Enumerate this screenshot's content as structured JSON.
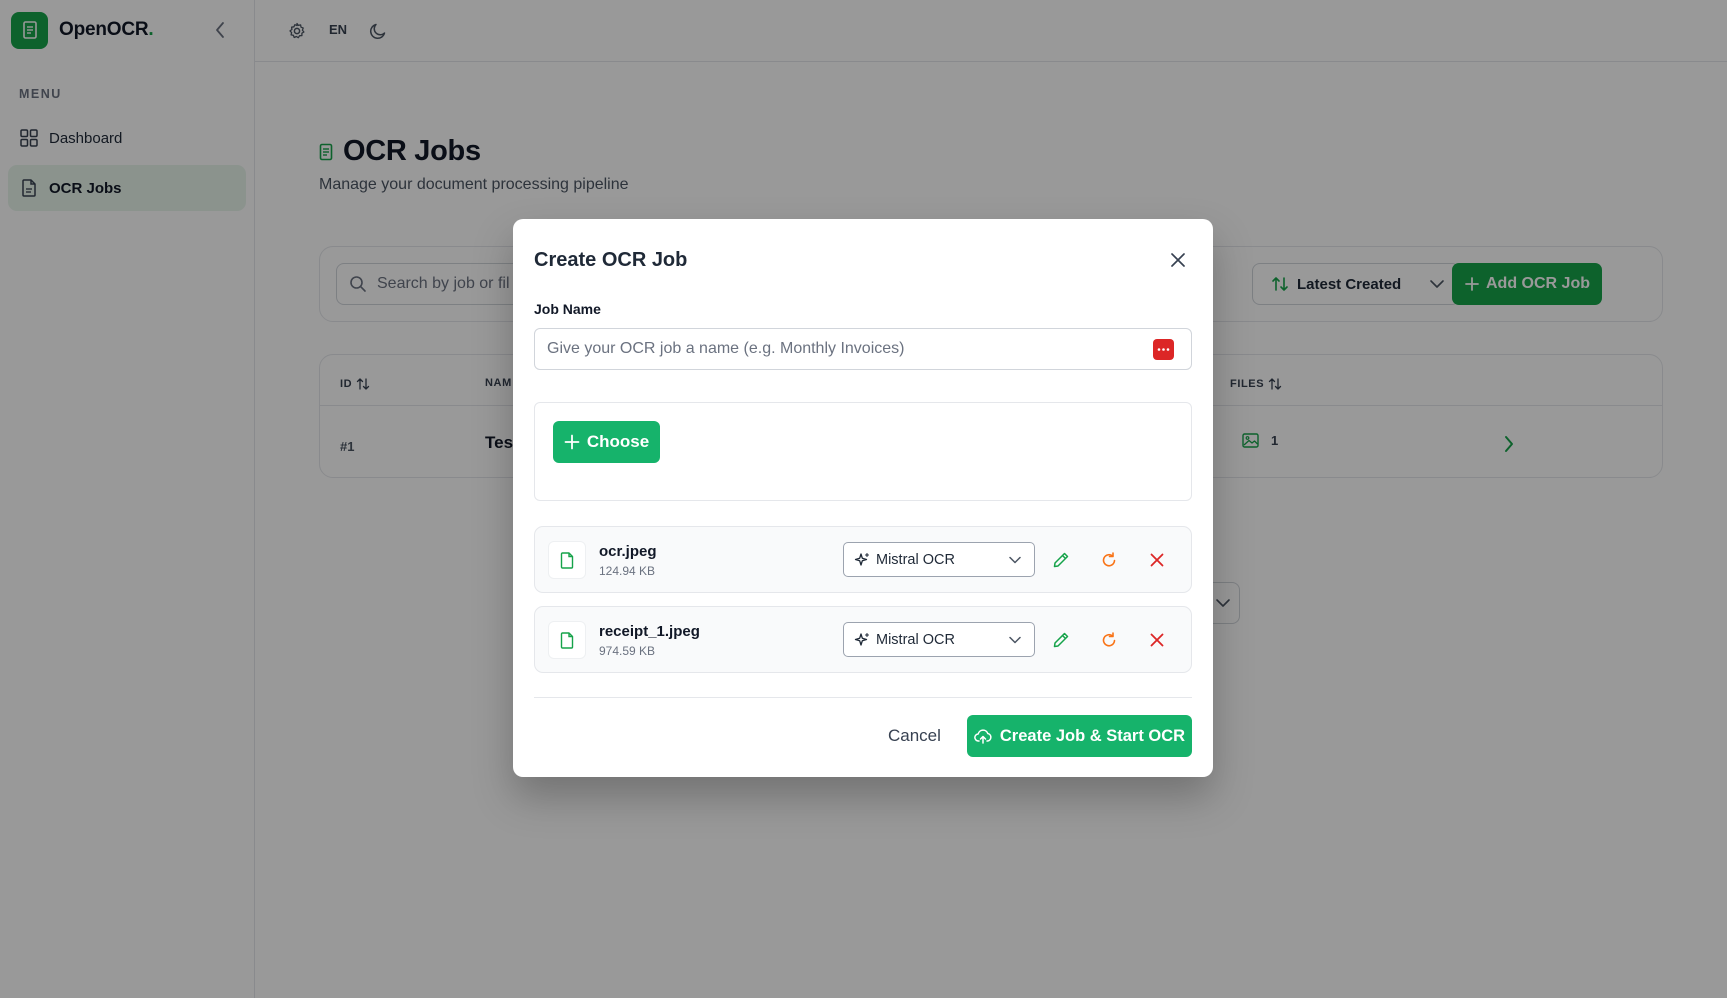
{
  "app": {
    "name": "OpenOCR",
    "name_suffix": "."
  },
  "sidebar": {
    "menu_label": "MENU",
    "items": [
      {
        "label": "Dashboard",
        "icon": "grid-icon",
        "active": false
      },
      {
        "label": "OCR Jobs",
        "icon": "document-icon",
        "active": true
      }
    ]
  },
  "topbar": {
    "language": "EN"
  },
  "page": {
    "title": "OCR Jobs",
    "subtitle": "Manage your document processing pipeline"
  },
  "toolbar": {
    "search_placeholder": "Search by job or fil",
    "sort_label": "Latest Created",
    "add_label": "Add OCR Job"
  },
  "table": {
    "columns": [
      "ID",
      "NAM",
      "FILES"
    ],
    "rows": [
      {
        "id": "#1",
        "name": "Tes",
        "files": "1"
      }
    ]
  },
  "modal": {
    "title": "Create OCR Job",
    "job_name_label": "Job Name",
    "job_name_placeholder": "Give your OCR job a name (e.g. Monthly Invoices)",
    "job_name_value": "",
    "choose_label": "Choose",
    "files": [
      {
        "name": "ocr.jpeg",
        "size": "124.94 KB",
        "engine": "Mistral OCR"
      },
      {
        "name": "receipt_1.jpeg",
        "size": "974.59 KB",
        "engine": "Mistral OCR"
      }
    ],
    "cancel_label": "Cancel",
    "submit_label": "Create Job & Start OCR"
  },
  "colors": {
    "brand": "#16a34a",
    "primary_button": "#16b36b",
    "edit_icon": "#16a34a",
    "retry_icon": "#f97316",
    "remove_icon": "#dc2626",
    "overlay": "rgba(0,0,0,0.4)"
  }
}
